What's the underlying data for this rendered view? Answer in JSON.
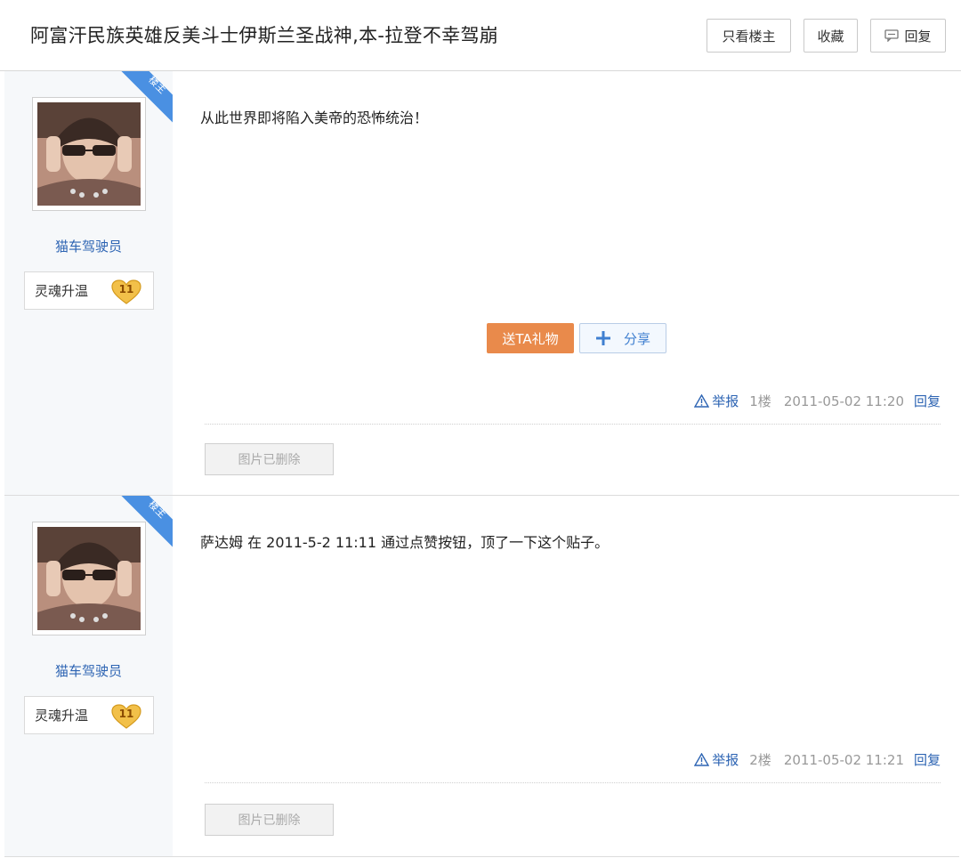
{
  "thread": {
    "title": "阿富汗民族英雄反美斗士伊斯兰圣战神,本-拉登不幸驾崩"
  },
  "header_buttons": {
    "only_op": "只看楼主",
    "favorite": "收藏",
    "reply": "回复",
    "reply_icon": "comment-icon"
  },
  "posts": [
    {
      "op_tag": "楼主",
      "username": "猫车驾驶员",
      "level_name": "灵魂升温",
      "level": "11",
      "content": "从此世界即将陷入美帝的恐怖统治！",
      "gift_label": "送TA礼物",
      "share_label": "分享",
      "report_label": "举报",
      "floor": "1楼",
      "time": "2011-05-02 11:20",
      "reply_label": "回复",
      "deleted_image_label": "图片已删除"
    },
    {
      "op_tag": "楼主",
      "username": "猫车驾驶员",
      "level_name": "灵魂升温",
      "level": "11",
      "content": "萨达姆 在 2011-5-2 11:11 通过点赞按钮，顶了一下这个贴子。",
      "report_label": "举报",
      "floor": "2楼",
      "time": "2011-05-02 11:21",
      "reply_label": "回复",
      "deleted_image_label": "图片已删除"
    }
  ],
  "colors": {
    "link_blue": "#2d64b3",
    "gift_orange": "#e98a4b",
    "op_tag_blue": "#4a90e2",
    "sidebar_bg": "#f6f8fa"
  }
}
